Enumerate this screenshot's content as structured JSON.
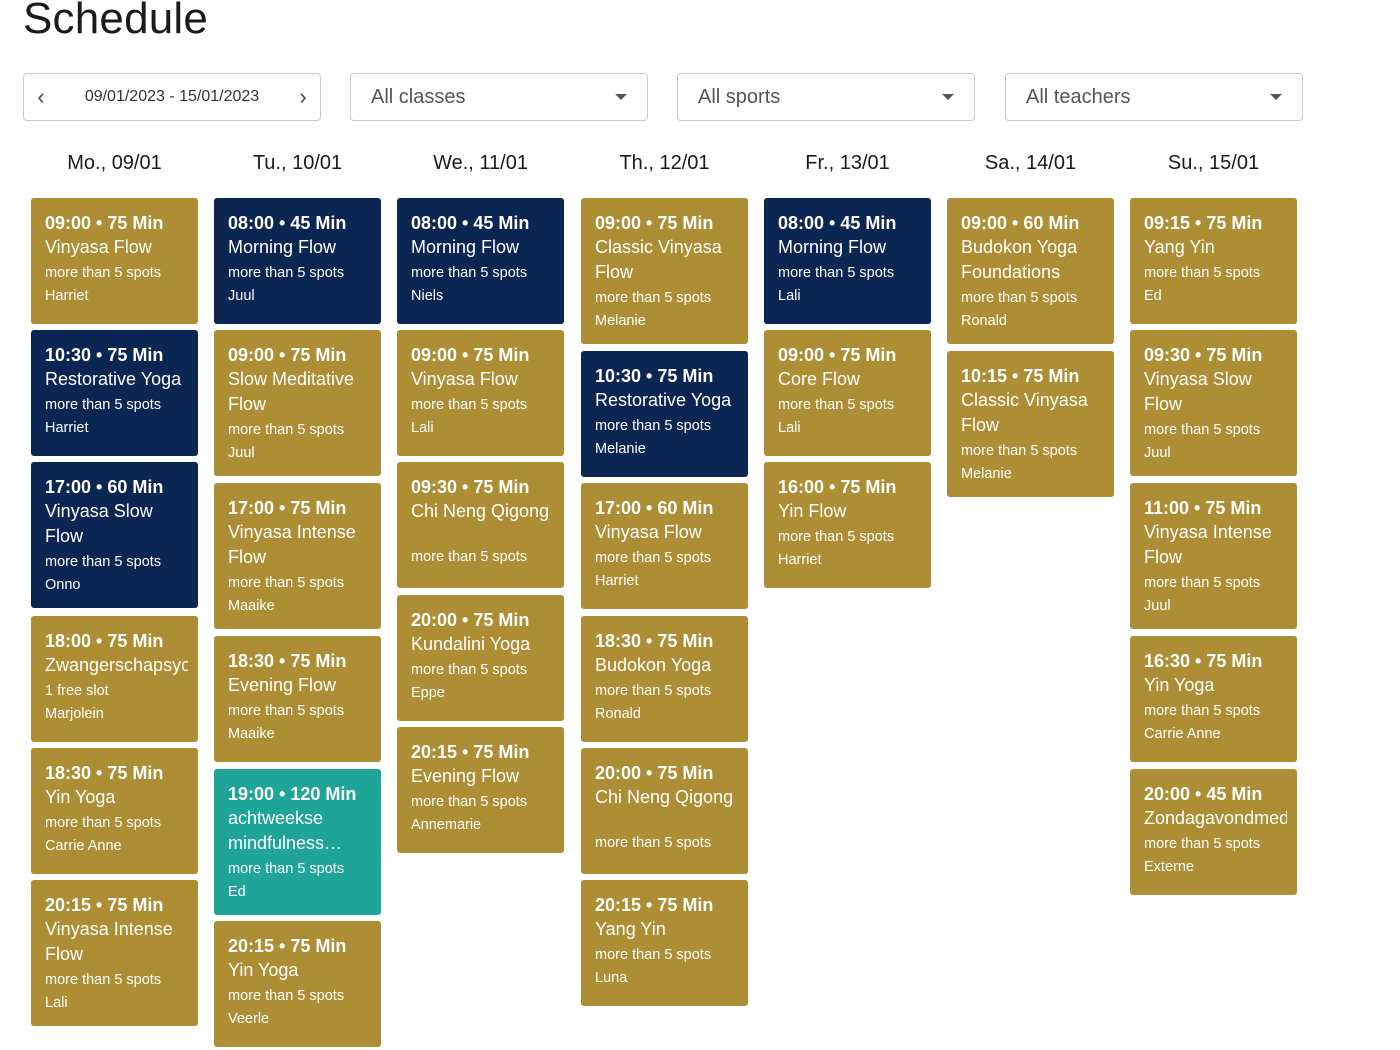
{
  "page_title": "Schedule",
  "filters": {
    "date_range": "09/01/2023 - 15/01/2023",
    "prev_icon": "chevron-left-icon",
    "next_icon": "chevron-right-icon",
    "classes": "All classes",
    "sports": "All sports",
    "teachers": "All teachers"
  },
  "colors": {
    "gold": "#ad8e34",
    "navy": "#0c2654",
    "teal": "#1fa597"
  },
  "days": [
    {
      "label": "Mo., 09/01",
      "classes": [
        {
          "time": "09:00 • 75 Min",
          "name": "Vinyasa Flow",
          "spots": "more than 5 spots",
          "teacher": "Harriet",
          "color": "gold"
        },
        {
          "time": "10:30 • 75 Min",
          "name": "Restorative Yoga",
          "spots": "more than 5 spots",
          "teacher": "Harriet",
          "color": "navy"
        },
        {
          "time": "17:00 • 60 Min",
          "name": "Vinyasa Slow Flow",
          "spots": "more than 5 spots",
          "teacher": "Onno",
          "color": "navy"
        },
        {
          "time": "18:00 • 75 Min",
          "name": "Zwangerschapsyoga",
          "spots": "1 free slot",
          "teacher": "Marjolein",
          "color": "gold"
        },
        {
          "time": "18:30 • 75 Min",
          "name": "Yin Yoga",
          "spots": "more than 5 spots",
          "teacher": "Carrie Anne",
          "color": "gold"
        },
        {
          "time": "20:15 • 75 Min",
          "name": "Vinyasa Intense Flow",
          "spots": "more than 5 spots",
          "teacher": "Lali",
          "color": "gold"
        }
      ]
    },
    {
      "label": "Tu., 10/01",
      "classes": [
        {
          "time": "08:00 • 45 Min",
          "name": "Morning Flow",
          "spots": "more than 5 spots",
          "teacher": "Juul",
          "color": "navy"
        },
        {
          "time": "09:00 • 75 Min",
          "name": "Slow Meditative Flow",
          "spots": "more than 5 spots",
          "teacher": "Juul",
          "color": "gold"
        },
        {
          "time": "17:00 • 75 Min",
          "name": "Vinyasa Intense Flow",
          "spots": "more than 5 spots",
          "teacher": "Maaike",
          "color": "gold"
        },
        {
          "time": "18:30 • 75 Min",
          "name": "Evening Flow",
          "spots": "more than 5 spots",
          "teacher": "Maaike",
          "color": "gold"
        },
        {
          "time": "19:00 • 120 Min",
          "name": "achtweekse mindfulness…",
          "spots": "more than 5 spots",
          "teacher": "Ed",
          "color": "teal"
        },
        {
          "time": "20:15 • 75 Min",
          "name": "Yin Yoga",
          "spots": "more than 5 spots",
          "teacher": "Veerle",
          "color": "gold"
        }
      ]
    },
    {
      "label": "We., 11/01",
      "classes": [
        {
          "time": "08:00 • 45 Min",
          "name": "Morning Flow",
          "spots": "more than 5 spots",
          "teacher": "Niels",
          "color": "navy"
        },
        {
          "time": "09:00 • 75 Min",
          "name": "Vinyasa Flow",
          "spots": "more than 5 spots",
          "teacher": "Lali",
          "color": "gold"
        },
        {
          "time": "09:30 • 75 Min",
          "name": "Chi Neng Qigong",
          "spots": "more than 5 spots",
          "teacher": "",
          "color": "gold"
        },
        {
          "time": "20:00 • 75 Min",
          "name": "Kundalini Yoga",
          "spots": "more than 5 spots",
          "teacher": "Eppe",
          "color": "gold"
        },
        {
          "time": "20:15 • 75 Min",
          "name": "Evening Flow",
          "spots": "more than 5 spots",
          "teacher": "Annemarie",
          "color": "gold"
        }
      ]
    },
    {
      "label": "Th., 12/01",
      "classes": [
        {
          "time": "09:00 • 75 Min",
          "name": "Classic Vinyasa Flow",
          "spots": "more than 5 spots",
          "teacher": "Melanie",
          "color": "gold"
        },
        {
          "time": "10:30 • 75 Min",
          "name": "Restorative Yoga",
          "spots": "more than 5 spots",
          "teacher": "Melanie",
          "color": "navy"
        },
        {
          "time": "17:00 • 60 Min",
          "name": "Vinyasa Flow",
          "spots": "more than 5 spots",
          "teacher": "Harriet",
          "color": "gold"
        },
        {
          "time": "18:30 • 75 Min",
          "name": "Budokon Yoga",
          "spots": "more than 5 spots",
          "teacher": "Ronald",
          "color": "gold"
        },
        {
          "time": "20:00 • 75 Min",
          "name": "Chi Neng Qigong",
          "spots": "more than 5 spots",
          "teacher": "",
          "color": "gold"
        },
        {
          "time": "20:15 • 75 Min",
          "name": "Yang Yin",
          "spots": "more than 5 spots",
          "teacher": "Luna",
          "color": "gold"
        }
      ]
    },
    {
      "label": "Fr., 13/01",
      "classes": [
        {
          "time": "08:00 • 45 Min",
          "name": "Morning Flow",
          "spots": "more than 5 spots",
          "teacher": "Lali",
          "color": "navy"
        },
        {
          "time": "09:00 • 75 Min",
          "name": "Core Flow",
          "spots": "more than 5 spots",
          "teacher": "Lali",
          "color": "gold"
        },
        {
          "time": "16:00 • 75 Min",
          "name": "Yin Flow",
          "spots": "more than 5 spots",
          "teacher": "Harriet",
          "color": "gold"
        }
      ]
    },
    {
      "label": "Sa., 14/01",
      "classes": [
        {
          "time": "09:00 • 60 Min",
          "name": "Budokon Yoga Foundations",
          "spots": "more than 5 spots",
          "teacher": "Ronald",
          "color": "gold"
        },
        {
          "time": "10:15 • 75 Min",
          "name": "Classic Vinyasa Flow",
          "spots": "more than 5 spots",
          "teacher": "Melanie",
          "color": "gold"
        }
      ]
    },
    {
      "label": "Su., 15/01",
      "classes": [
        {
          "time": "09:15 • 75 Min",
          "name": "Yang Yin",
          "spots": "more than 5 spots",
          "teacher": "Ed",
          "color": "gold"
        },
        {
          "time": "09:30 • 75 Min",
          "name": "Vinyasa Slow Flow",
          "spots": "more than 5 spots",
          "teacher": "Juul",
          "color": "gold"
        },
        {
          "time": "11:00 • 75 Min",
          "name": "Vinyasa Intense Flow",
          "spots": "more than 5 spots",
          "teacher": "Juul",
          "color": "gold"
        },
        {
          "time": "16:30 • 75 Min",
          "name": "Yin Yoga",
          "spots": "more than 5 spots",
          "teacher": "Carrie Anne",
          "color": "gold"
        },
        {
          "time": "20:00 • 45 Min",
          "name": "Zondagavondmeditatie",
          "spots": "more than 5 spots",
          "teacher": "Externe",
          "color": "gold"
        }
      ]
    }
  ]
}
